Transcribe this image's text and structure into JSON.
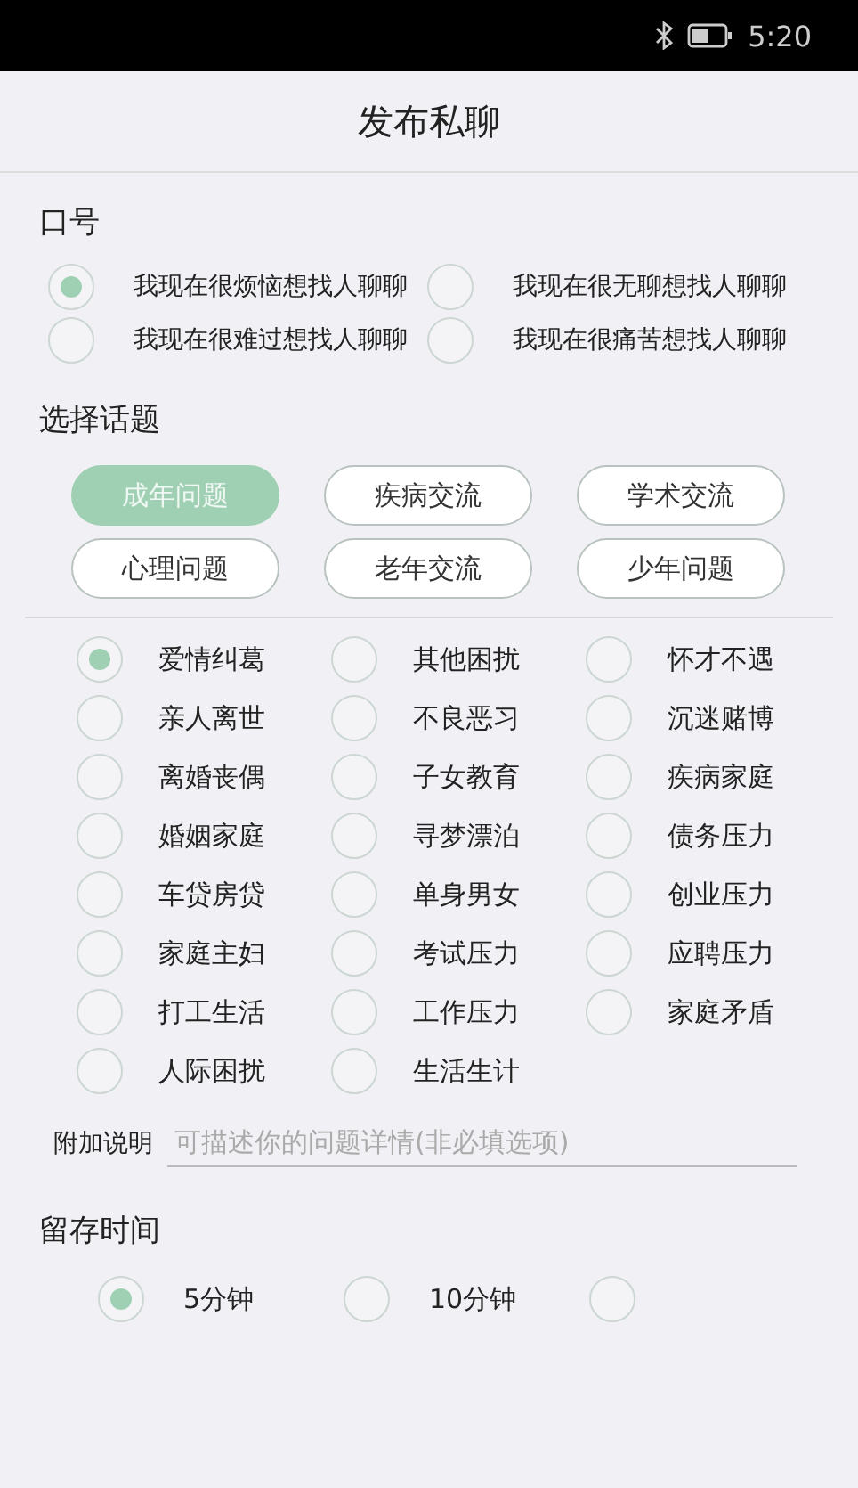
{
  "status_bar": {
    "time": "5:20"
  },
  "title": "发布私聊",
  "slogan": {
    "label": "口号",
    "options": [
      {
        "text": "我现在很烦恼想找人聊聊",
        "selected": true
      },
      {
        "text": "我现在很无聊想找人聊聊",
        "selected": false
      },
      {
        "text": "我现在很难过想找人聊聊",
        "selected": false
      },
      {
        "text": "我现在很痛苦想找人聊聊",
        "selected": false
      }
    ]
  },
  "topic": {
    "label": "选择话题",
    "categories": [
      {
        "text": "成年问题",
        "selected": true
      },
      {
        "text": "疾病交流",
        "selected": false
      },
      {
        "text": "学术交流",
        "selected": false
      },
      {
        "text": "心理问题",
        "selected": false
      },
      {
        "text": "老年交流",
        "selected": false
      },
      {
        "text": "少年问题",
        "selected": false
      }
    ],
    "items": [
      {
        "text": "爱情纠葛",
        "selected": true
      },
      {
        "text": "其他困扰",
        "selected": false
      },
      {
        "text": "怀才不遇",
        "selected": false
      },
      {
        "text": "亲人离世",
        "selected": false
      },
      {
        "text": "不良恶习",
        "selected": false
      },
      {
        "text": "沉迷赌博",
        "selected": false
      },
      {
        "text": "离婚丧偶",
        "selected": false
      },
      {
        "text": "子女教育",
        "selected": false
      },
      {
        "text": "疾病家庭",
        "selected": false
      },
      {
        "text": "婚姻家庭",
        "selected": false
      },
      {
        "text": "寻梦漂泊",
        "selected": false
      },
      {
        "text": "债务压力",
        "selected": false
      },
      {
        "text": "车贷房贷",
        "selected": false
      },
      {
        "text": "单身男女",
        "selected": false
      },
      {
        "text": "创业压力",
        "selected": false
      },
      {
        "text": "家庭主妇",
        "selected": false
      },
      {
        "text": "考试压力",
        "selected": false
      },
      {
        "text": "应聘压力",
        "selected": false
      },
      {
        "text": "打工生活",
        "selected": false
      },
      {
        "text": "工作压力",
        "selected": false
      },
      {
        "text": "家庭矛盾",
        "selected": false
      },
      {
        "text": "人际困扰",
        "selected": false
      },
      {
        "text": "生活生计",
        "selected": false
      }
    ]
  },
  "note": {
    "label": "附加说明",
    "placeholder": "可描述你的问题详情(非必填选项)"
  },
  "retention": {
    "label": "留存时间",
    "options": [
      {
        "text": "5分钟",
        "selected": true
      },
      {
        "text": "10分钟",
        "selected": false
      },
      {
        "selected": false
      }
    ]
  }
}
